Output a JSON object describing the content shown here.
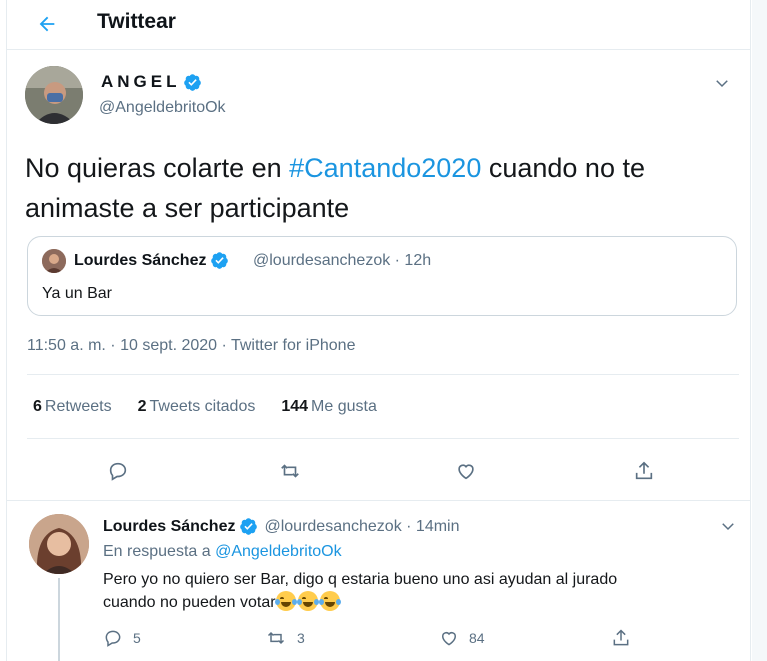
{
  "header": {
    "title": "Twittear"
  },
  "tweet": {
    "author_name": "ANGEL",
    "author_handle": "@AngeldebritoOk",
    "text_before": "No quieras colarte en ",
    "hashtag": "#Cantando2020",
    "text_after": " cuando no te animaste a ser participante",
    "quote": {
      "name": "Lourdes Sánchez",
      "meta": "@lourdesanchezok · 12h",
      "text": "Ya un Bar"
    },
    "timestamp": "11:50 a. m. · 10 sept. 2020 · Twitter for iPhone",
    "stats": {
      "retweets_count": "6",
      "retweets_label": "Retweets",
      "quotes_count": "2",
      "quotes_label": "Tweets citados",
      "likes_count": "144",
      "likes_label": "Me gusta"
    }
  },
  "reply": {
    "name": "Lourdes Sánchez",
    "meta": "@lourdesanchezok · 14min",
    "replying_prefix": "En respuesta a ",
    "replying_to": "@AngeldebritoOk",
    "text_line1": "Pero yo no quiero ser Bar, digo q estaria bueno uno asi ayudan al jurado",
    "text_line2": "cuando no pueden votar",
    "replies": "5",
    "retweets": "3",
    "likes": "84"
  },
  "colors": {
    "accent": "#1da1f2",
    "link": "#1b95e0",
    "muted": "#5b7083"
  },
  "icons": [
    "back-arrow-icon",
    "verified-badge-icon",
    "chevron-down-icon",
    "reply-icon",
    "retweet-icon",
    "like-icon",
    "share-icon",
    "tears-of-joy-emoji"
  ]
}
